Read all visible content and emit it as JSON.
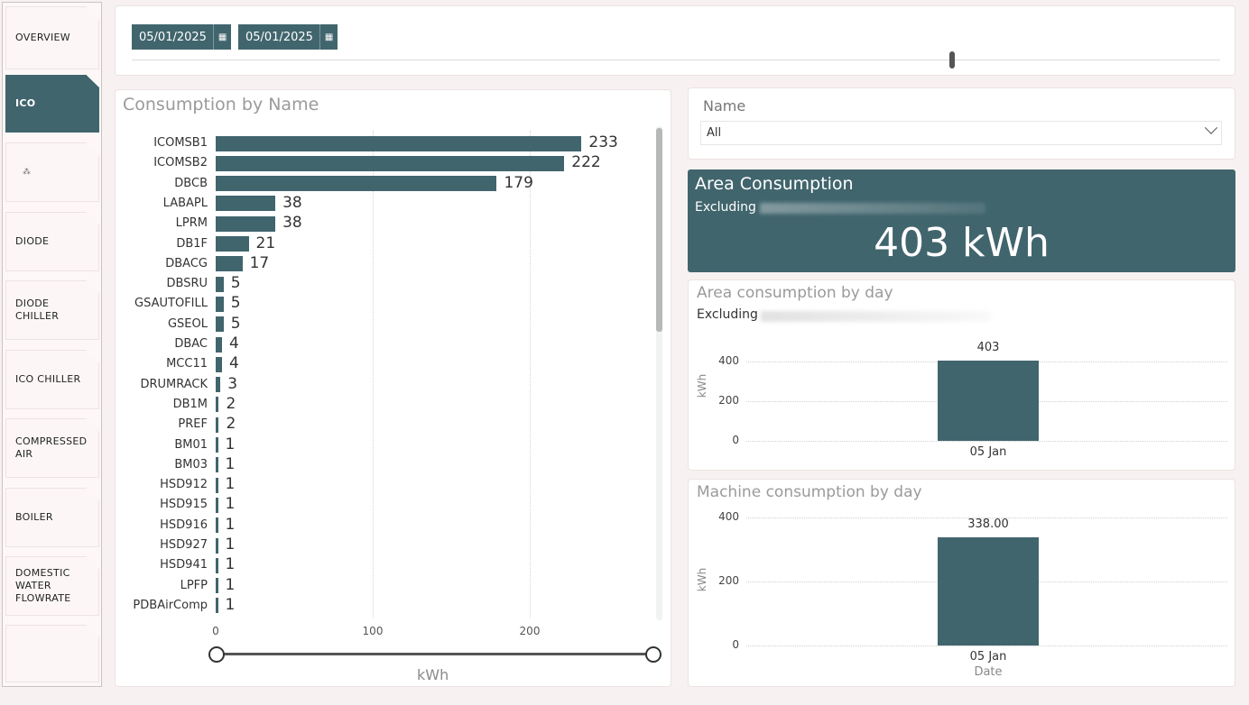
{
  "sidebar": {
    "items": [
      {
        "label": "OVERVIEW",
        "active": false
      },
      {
        "label": "ICO",
        "active": true
      },
      {
        "label": "",
        "active": false
      },
      {
        "label": "DIODE",
        "active": false
      },
      {
        "label": "DIODE\nCHILLER",
        "active": false
      },
      {
        "label": "ICO CHILLER",
        "active": false
      },
      {
        "label": "COMPRESSED\nAIR",
        "active": false
      },
      {
        "label": "BOILER",
        "active": false
      },
      {
        "label": "DOMESTIC\nWATER\nFLOWRATE",
        "active": false
      },
      {
        "label": "",
        "active": false
      }
    ]
  },
  "date_filter": {
    "start": "05/01/2025",
    "end": "05/01/2025",
    "calendar_icon": "calendar-icon"
  },
  "name_slicer": {
    "title": "Name",
    "selected": "All",
    "dropdown_icon": "chevron-down-icon"
  },
  "area_card": {
    "title": "Area Consumption",
    "subtitle": "Excluding",
    "value": "403 kWh"
  },
  "consumption_chart": {
    "title": "Consumption by Name",
    "axis_title": "kWh"
  },
  "area_day_chart": {
    "title": "Area consumption by day",
    "subtitle": "Excluding"
  },
  "machine_day_chart": {
    "title": "Machine consumption by day"
  },
  "colors": {
    "accent": "#41656d",
    "background": "#f7f2f1"
  },
  "chart_data": [
    {
      "type": "bar",
      "orientation": "horizontal",
      "title": "Consumption by Name",
      "xlabel": "kWh",
      "xlim": [
        0,
        280
      ],
      "xticks": [
        "0",
        "100",
        "200"
      ],
      "categories": [
        "ICOMSB1",
        "ICOMSB2",
        "DBCB",
        "LABAPL",
        "LPRM",
        "DB1F",
        "DBACG",
        "DBSRU",
        "GSAUTOFILL",
        "GSEOL",
        "DBAC",
        "MCC11",
        "DRUMRACK",
        "DB1M",
        "PREF",
        "BM01",
        "BM03",
        "HSD912",
        "HSD915",
        "HSD916",
        "HSD927",
        "HSD941",
        "LPFP",
        "PDBAirComp"
      ],
      "values": [
        233,
        222,
        179,
        38,
        38,
        21,
        17,
        5,
        5,
        5,
        4,
        4,
        3,
        2,
        2,
        1,
        1,
        1,
        1,
        1,
        1,
        1,
        1,
        1
      ],
      "value_labels": [
        "233",
        "222",
        "179",
        "38",
        "38",
        "21",
        "17",
        "5",
        "5",
        "5",
        "4",
        "4",
        "3",
        "2",
        "2",
        "1",
        "1",
        "1",
        "1",
        "1",
        "1",
        "1",
        "1",
        "1"
      ],
      "grid": true
    },
    {
      "type": "bar",
      "title": "Area consumption by day",
      "ylabel": "kWh",
      "ylim": [
        0,
        480
      ],
      "yticks": [
        "0",
        "200",
        "400"
      ],
      "categories": [
        "05 Jan"
      ],
      "values": [
        403
      ],
      "value_labels": [
        "403"
      ],
      "grid": true
    },
    {
      "type": "bar",
      "title": "Machine consumption by day",
      "ylabel": "kWh",
      "xlabel": "Date",
      "ylim": [
        0,
        400
      ],
      "yticks": [
        "0",
        "200",
        "400"
      ],
      "categories": [
        "05 Jan"
      ],
      "values": [
        338
      ],
      "value_labels": [
        "338.00"
      ],
      "grid": true
    }
  ]
}
